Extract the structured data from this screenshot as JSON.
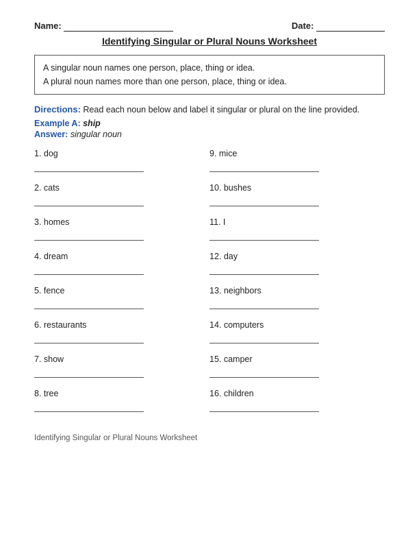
{
  "header": {
    "name_label": "Name:",
    "date_label": "Date:"
  },
  "title": "Identifying Singular or Plural Nouns Worksheet",
  "info_box": {
    "line1": "A singular noun names one person, place, thing or idea.",
    "line2": "A plural noun names more than one person, place, thing or idea."
  },
  "directions": {
    "label": "Directions:",
    "text": "Read each noun below and label it singular or plural on the line provided."
  },
  "example": {
    "label": "Example A:",
    "word": "ship"
  },
  "answer": {
    "label": "Answer:",
    "text": "singular noun"
  },
  "questions": [
    {
      "number": "1.",
      "word": "dog"
    },
    {
      "number": "9.",
      "word": "mice"
    },
    {
      "number": "2.",
      "word": "cats"
    },
    {
      "number": "10.",
      "word": "bushes"
    },
    {
      "number": "3.",
      "word": "homes"
    },
    {
      "number": "11.",
      "word": "I"
    },
    {
      "number": "4.",
      "word": "dream"
    },
    {
      "number": "12.",
      "word": "day"
    },
    {
      "number": "5.",
      "word": "fence"
    },
    {
      "number": "13.",
      "word": "neighbors"
    },
    {
      "number": "6.",
      "word": "restaurants"
    },
    {
      "number": "14.",
      "word": "computers"
    },
    {
      "number": "7.",
      "word": "show"
    },
    {
      "number": "15.",
      "word": "camper"
    },
    {
      "number": "8.",
      "word": "tree"
    },
    {
      "number": "16.",
      "word": "children"
    }
  ],
  "footer": "Identifying Singular or Plural Nouns Worksheet"
}
